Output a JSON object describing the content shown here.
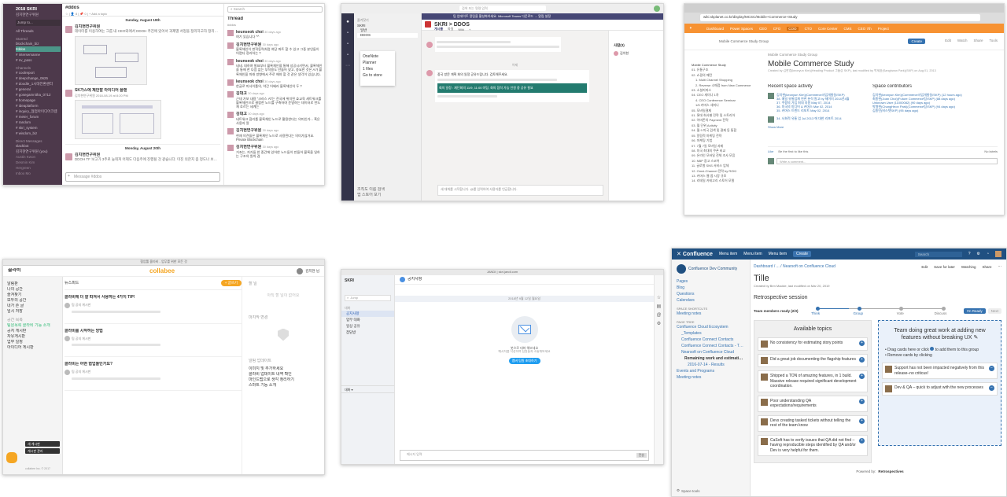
{
  "slack": {
    "team": "2018 SKRI",
    "user": "김치현연구위원",
    "jump": "Jump to...",
    "all_threads": "All Threads",
    "sections": {
      "starred": "Starred",
      "channels": "Channels",
      "dms": "Direct Messages"
    },
    "starred": [
      "blockchain_biz",
      "#ddos",
      "# intersemanne",
      "# nv_pass"
    ],
    "channels": [
      "# coolreport",
      "# deepchange_0625",
      "# doodle_1시대전환센터",
      "# general",
      "# gosegamnitha_0712",
      "# homepage",
      "# ideaplatform",
      "# inquiry_협업아이디어크렘",
      "# meter_forum",
      "# random",
      "# skri_system",
      "# wisdom_biz"
    ],
    "dms": [
      "slackbot",
      "김치현연구위원 (you)",
      "Austin Kwon",
      "Desmin Kim",
      "Hergreen",
      "Inboo Mo"
    ],
    "channel_title": "#ddos",
    "channel_meta": "☆ | 👤 8 | 📌 0 | + Add a topic",
    "date1": "Sunday, August 19th",
    "date2": "Monday, August 20th",
    "messages": [
      {
        "name": "김치현연구위원",
        "time": "8:17 PM",
        "text": "데이터를 이용하여는 그룹 내 CEO와에서 DDOH 추진에 있어서 과제별 서정을 정리하고자 정리한 tree map"
      },
      {
        "name": "SK가스에 제안할 아이디어 플랜",
        "time": "",
        "text": "김치현연구위원 2018-08-19 at 8:20 PM"
      },
      {
        "name": "김치현연구위원",
        "time": "8:20 AM",
        "text": "DDOH TF 보고가 3주로 늦춰져 어제도 다음주에 진행될 것 같습니다. 미진 의한지 좀 정도나 보고형 만들어야"
      }
    ],
    "input_placeholder": "Message #ddos",
    "thread_title": "Thread",
    "thread_sub": "#ddos",
    "search_placeholder": "Search",
    "thread_msgs": [
      {
        "name": "keunseok choi",
        "time": "30 days ago",
        "text": "여기 있습니다 ^^"
      },
      {
        "name": "김치현연구위원",
        "time": "30 days ago",
        "text": "블록체인이 변혁동력처럼 여당 파트 할 수 있고 그중 본인들이 어렵다 정리하는 ?"
      },
      {
        "name": "keunseok choi",
        "time": "30 days ago",
        "text": "네네. 대하여 발표부터 블록체인을 통해 성공시키면서, 블록체인을 통해 한 다음 없는 부작용도 만들어 냈고, 중요한 것은 A가 블록체인을 미래 방향에서 주로 해야 할 것 같은 생각이 있습니다."
      },
      {
        "name": "keunseok choi",
        "time": "30 days ago",
        "text": "한글로 미사이틀의, 약간 어쌔러 블록체인의 두 ?"
      },
      {
        "name": "김대고",
        "time": "30 days ago",
        "text": "근데 가보 내용 \"크라스 AT는 전국에 위치된 효교육 세트워크를 블록체인으로 결합한 노드를 구축하여 운영하는 데이터로 반도체 흐르는 세계는"
      },
      {
        "name": "김대고",
        "time": "30 days ago",
        "text": "네트워크 합리를 블록체인 노드로 활용한다는 의미인가... 혹은 사용자 알"
      },
      {
        "name": "김치현연구위원",
        "time": "30 days ago",
        "text": "현재 의견들은 블록체인 노드로 사용된다는 의미가않거요. Private Blockchain"
      },
      {
        "name": "김치현연구위원",
        "time": "30 days ago",
        "text": "거죠는, 저가들 한 중간에 있어한 노드들이 만들어 블록을 일하는 구조의 원칙 겸"
      }
    ]
  },
  "teams": {
    "search": "검색 또는 명령 입력",
    "banner": "팀 업데이트 알림을 활성화하세요. Microsoft Teams 다운로드 → 알림 설정",
    "header_title": "SKRI > DDOS",
    "tabs": [
      "게시물",
      "파일",
      "Wiki",
      "+"
    ],
    "team_list": [
      "즐겨찾기",
      "SKRI",
      "일반",
      "DDOS"
    ],
    "favorites": [
      "OneNote",
      "Planner",
      "1 files",
      "Go to store"
    ],
    "day": "어제",
    "message": "중국 방문 계획 회의 일정 공유드립니다. 검토해주세요.",
    "highlight": "회의 일정 : 재단회의 11/9, 11:00 미팅, 회의 참석 가능 인원 중 공유 필요",
    "sidebar_title": "사람(3)",
    "sidebar_person": "김치현",
    "compose": "새 대화를 시작합니다. @를 입력하여 사용자를 언급합니다.",
    "bottom_items": [
      "조직도 이름 검색",
      "앱 스토어 보기"
    ]
  },
  "confluence1": {
    "url": "wiki.skplanet.co.kr/display/MCSC/Mobile+Commerce+Study",
    "nav": [
      "Dashboard",
      "Power Spaces",
      "CEO",
      "CFO",
      "COO",
      "CTO",
      "Core Center",
      "CMS",
      "CEO 7th",
      "Project"
    ],
    "create": "Create",
    "tools": [
      "Edit",
      "Watch",
      "Share",
      "Tools"
    ],
    "breadcrumb": "Mobile Commerce Study Group",
    "title": "Mobile Commerce Study",
    "byline": "Created by 김한명(keonyun Kim)(Heading Product 그룹장 SKP), last modified by 박세환(Sanghwan Park)(SKP) on Aug 01, 2013",
    "tree": [
      "Mobile Commerce Study",
      "01. 유통구조",
      "02. 쇼핑의 패턴",
      "1. Multi Channel Shopping",
      "2. Reverse 소매점 from New Commerce",
      "03. 소셜커머스",
      "04. CEO 세미나 1차",
      "4. CEO Conference Seminar",
      "1/5 커머스 세미나",
      "05. 모바일결제",
      "01. 롯데 회사별 전략 및 스토리아",
      "02. 아마존의 Payment 전략",
      "03. 월 단위 Activity",
      "04. 월 9 미국 검색 및 결제 동 통합",
      "05. 알림적 마케팅 전략",
      "06. 마케팅 기법",
      "07. 7월 7일 모바일 과제",
      "08. 미국 최대의 쿠폰 비교",
      "09. 온라인 모바일 전체 조사 모음",
      "10. NBP 광고 스코어",
      "11. 글로벌 SNS 서비스 업체",
      "12. Omni-Channel 전략 by ROKI",
      "13. 커머스 웹 앱 시장 규모",
      "14. 리테일 카테고리 스토어 모델"
    ],
    "recent_title": "Recent space activity",
    "recent": [
      {
        "name": "김치현(keonyun Kim)(Commerce사업개발실/SKP)",
        "items": [
          "38. 매일 유통업체 연관 분석 원고 by 제이미 2014년4월",
          "37. 쿠팡의 가입 최대 지원 May 07, 2014",
          "36. 미국의 미디어 & 커머스 Mar 02, 2014",
          "35. 커머스 트렌드 리포트 May 02, 2014"
        ]
      },
      {
        "name": "",
        "items": [
          "34. 사회적 유통 업 Jul 2013 에 대한 리포트 2014"
        ]
      }
    ],
    "show_more": "Show More",
    "contrib_title": "Space contributors",
    "contributors": [
      "김치현(keonyun Kim)(Commerce사업개발실/SKP) (12 hours ago)",
      "최종현(Joan Choi)(Future Commerce팀/SKP) (88 days ago)",
      "Unknown User (11000082) (90 days ago)",
      "박형현(ChangHeon Park)(Commerce팀/SKP) (94 days ago)",
      "김종민(비스탯SKP) (95 days ago)"
    ],
    "like": "Like",
    "like_text": "Be the first to like this",
    "labels": "No labels",
    "comment": "Write a comment..."
  },
  "collabee": {
    "window_title": "협업툴 콜라비 - 업무를 위한 모든 것",
    "brand": "collabee",
    "workspace": "콜라비",
    "side_items": [
      "알림판",
      "나의 공간",
      "즐겨찾기",
      "모두의 공간",
      "내가 쓴 글",
      "임시 저장"
    ],
    "side_section": "공간 목록",
    "side_spaces": [
      "팀원목록 콜라비 기능 소개",
      "공지 게시판",
      "자유게시판",
      "업무 일정",
      "아이디어 게시판"
    ],
    "user": "김치현 님",
    "feed_label": "뉴스피드",
    "new_button": "+ 글쓰기",
    "posts": [
      {
        "title": "콜라비에 더 잘 따져서 사용하는 4가지 TIP!",
        "meta": "팀 공지 게시판"
      },
      {
        "title": "콜라비를 시작하는 방법",
        "meta": "팀 공지 게시판"
      },
      {
        "title": "콜라비는 어떤 협업툴인가요?",
        "meta": "팀 공지 게시판"
      }
    ],
    "right_sections": [
      "할 일",
      "마지막 변경",
      "알림 업데이트"
    ],
    "right_empty": "아직 할 일이 없어요",
    "right_notes": [
      "이미지 및 추가하세요",
      "콜라비 업데이트 내역 확인",
      "마인드맵으로 생각 정리하기",
      "스마트 기능 소개"
    ],
    "bottom_buttons": [
      "새 게시판",
      "게시판 관리"
    ],
    "footer": "collabee Inc. © 2017"
  },
  "jandi": {
    "window_title": "JANDI | skri.jandi.com",
    "team": "SKRI",
    "room": "공지사항",
    "jump": "Jump",
    "side_items": [
      "공지사항",
      "업무 대화",
      "일상 공유",
      "잡담방"
    ],
    "side_section": "대화",
    "date": "2018년 9월 12일 월요일",
    "empty_title": "봇으로 대화 해보세요",
    "empty_sub": "메시지를 작성하여 팀원들과 소통해보세요",
    "cta": "멤버 팀원 초대하기",
    "input_placeholder": "메시지 입력",
    "send": "전송"
  },
  "confluence2": {
    "brand": "Confluence",
    "nav": [
      "Menu item",
      "Menu item",
      "Menu item"
    ],
    "create": "Create",
    "search": "Search",
    "space_name": "Confluence Dev Community",
    "side_links": [
      "Pages",
      "Blog",
      "Questions",
      "Calendars"
    ],
    "shortcuts_title": "SPACE SHORTCUTS",
    "shortcuts": [
      "Meeting notes"
    ],
    "page_tree_title": "PAGE TREE",
    "page_tree": [
      "Confluence Cloud Ecosystem",
      "_Templates",
      "Confluence Connect Contacts",
      "Confluence Connect Contacts - Three",
      "Nearsoft on Confluence Cloud",
      "Remaining work and estimations",
      "2016-07-14 - Results",
      "Events and Programs",
      "Meeting notes"
    ],
    "space_tools": "Space tools",
    "breadcrumb": "Dashboard / ... / Nearsoft on Confluence Cloud",
    "actions": [
      "Edit",
      "Save for later",
      "Watching",
      "Share"
    ],
    "title": "Tille",
    "byline": "Created by Ben Mackie, last modified on Mar 20, 2019",
    "session": "Retrospective session",
    "ready": "Team members ready (2/3)",
    "steps": [
      "Think",
      "Group",
      "Vote",
      "Discuss"
    ],
    "im_ready": "I'm Ready",
    "next": "Next",
    "available": "Available topics",
    "topics": [
      "No consistency for estimating story points",
      "Did a great job documenting the flagship features",
      "Shipped a TON of amazing features, in 1 build. Massive release required significant development coordination.",
      "Poor understanding QA expectations/requirements",
      "Devs creating tasked tickets without telling the rest of the team know",
      "CaSoft has to verify issues that QA did not find – having reproducible steps identified by QA and/or Dev is very helpful for them."
    ],
    "group_title": "Team doing great work at adding new features without breaking UX",
    "group_hints": [
      "Drag cards here or click",
      "to add them to this group",
      "Remove cards by clicking"
    ],
    "group_cards": [
      "Support has not been impacted negatively from this release–no criticus!",
      "Dev & QA – quick to adjust with the new processes"
    ],
    "powered": "Powered by:",
    "powered_brand": "Retrospectives"
  }
}
